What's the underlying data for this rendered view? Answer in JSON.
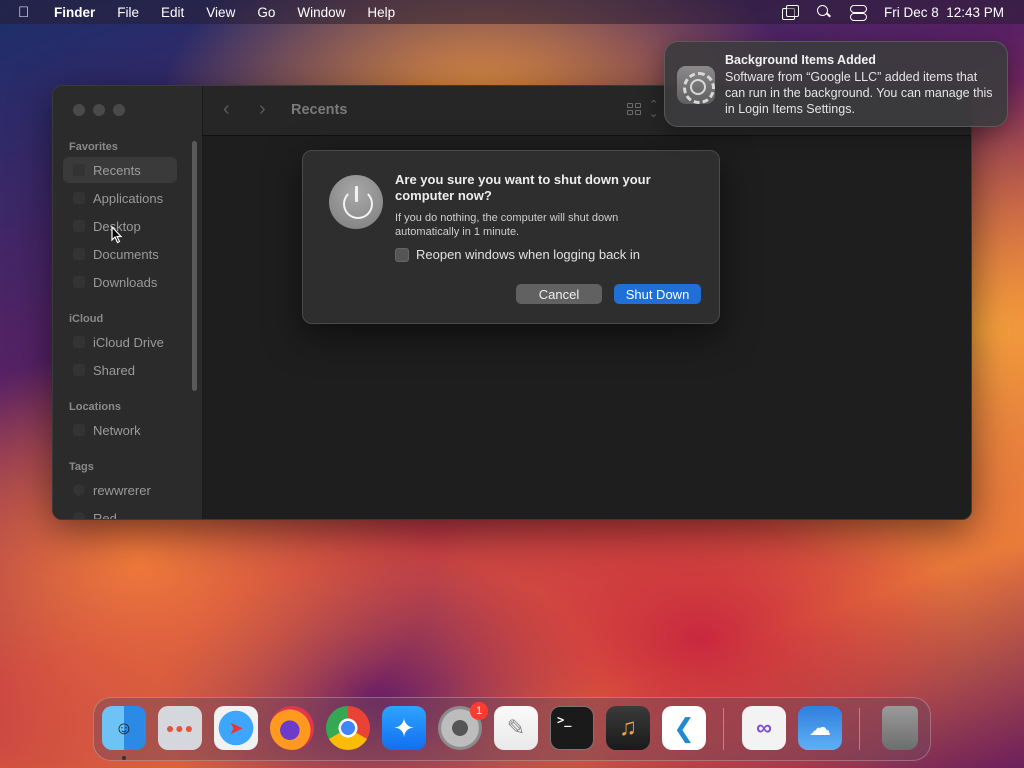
{
  "menubar": {
    "app_name": "Finder",
    "items": [
      "File",
      "Edit",
      "View",
      "Go",
      "Window",
      "Help"
    ],
    "datetime": "Fri Dec 8  12:43 PM"
  },
  "finder": {
    "title": "Recents",
    "sidebar": {
      "sections": {
        "favorites": "Favorites",
        "icloud": "iCloud",
        "locations": "Locations",
        "tags": "Tags"
      },
      "items": {
        "recents": "Recents",
        "applications": "Applications",
        "desktop": "Desktop",
        "documents": "Documents",
        "downloads": "Downloads",
        "icloud_drive": "iCloud Drive",
        "shared": "Shared",
        "network": "Network",
        "tag1": "rewwrerer",
        "tag2": "Red"
      }
    }
  },
  "dialog": {
    "title": "Are you sure you want to shut down your computer now?",
    "message": "If you do nothing, the computer will shut down automatically in 1 minute.",
    "checkbox_label": "Reopen windows when logging back in",
    "checkbox_checked": false,
    "cancel_label": "Cancel",
    "confirm_label": "Shut Down",
    "accent_color": "#1f6fd6"
  },
  "notification": {
    "title": "Background Items Added",
    "body": "Software from “Google LLC” added items that can run in the background. You can manage this in Login Items Settings."
  },
  "dock": {
    "settings_badge": "1",
    "apps": [
      "finder-icon",
      "launchpad-icon",
      "safari-icon",
      "firefox-icon",
      "chrome-icon",
      "app-store-icon",
      "system-settings-icon",
      "textedit-icon",
      "terminal-icon",
      "garageband-icon",
      "vscode-icon",
      "visual-studio-icon",
      "weather-icon",
      "trash-icon"
    ]
  }
}
